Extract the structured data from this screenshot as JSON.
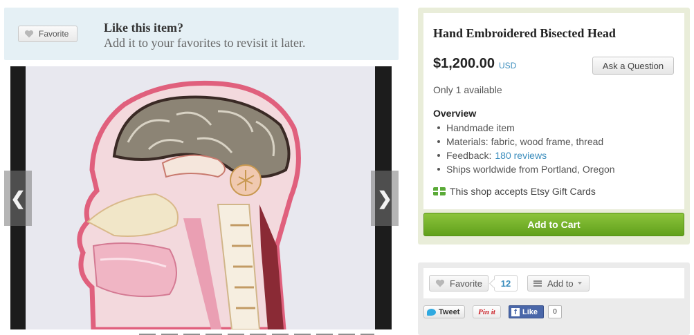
{
  "favorite_banner": {
    "button_label": "Favorite",
    "title": "Like this item?",
    "subtitle": "Add it to your favorites to revisit it later."
  },
  "image_viewer": {
    "prev_icon": "chevron-left-icon",
    "next_icon": "chevron-right-icon",
    "image_subject": "embroidered bisected human head anatomy"
  },
  "listing": {
    "title": "Hand Embroidered Bisected Head",
    "price": "$1,200.00",
    "currency": "USD",
    "ask_button": "Ask a Question",
    "availability": "Only 1 available",
    "overview_heading": "Overview",
    "overview": {
      "handmade": "Handmade item",
      "materials": "Materials: fabric, wood frame, thread",
      "feedback_label": "Feedback:",
      "feedback_link": "180 reviews",
      "ships": "Ships worldwide from Portland, Oregon"
    },
    "gift_cards": "This shop accepts Etsy Gift Cards",
    "add_to_cart": "Add to Cart"
  },
  "social": {
    "favorite_label": "Favorite",
    "favorite_count": "12",
    "add_to_label": "Add to",
    "tweet_label": "Tweet",
    "pin_label": "Pin it",
    "like_label": "Like",
    "like_count": "0"
  },
  "colors": {
    "banner_bg": "#e5f0f5",
    "listing_panel_bg": "#e9edd9",
    "cart_green": "#7ab42c",
    "link_blue": "#3b8dbd",
    "facebook_blue": "#4a67a9"
  }
}
